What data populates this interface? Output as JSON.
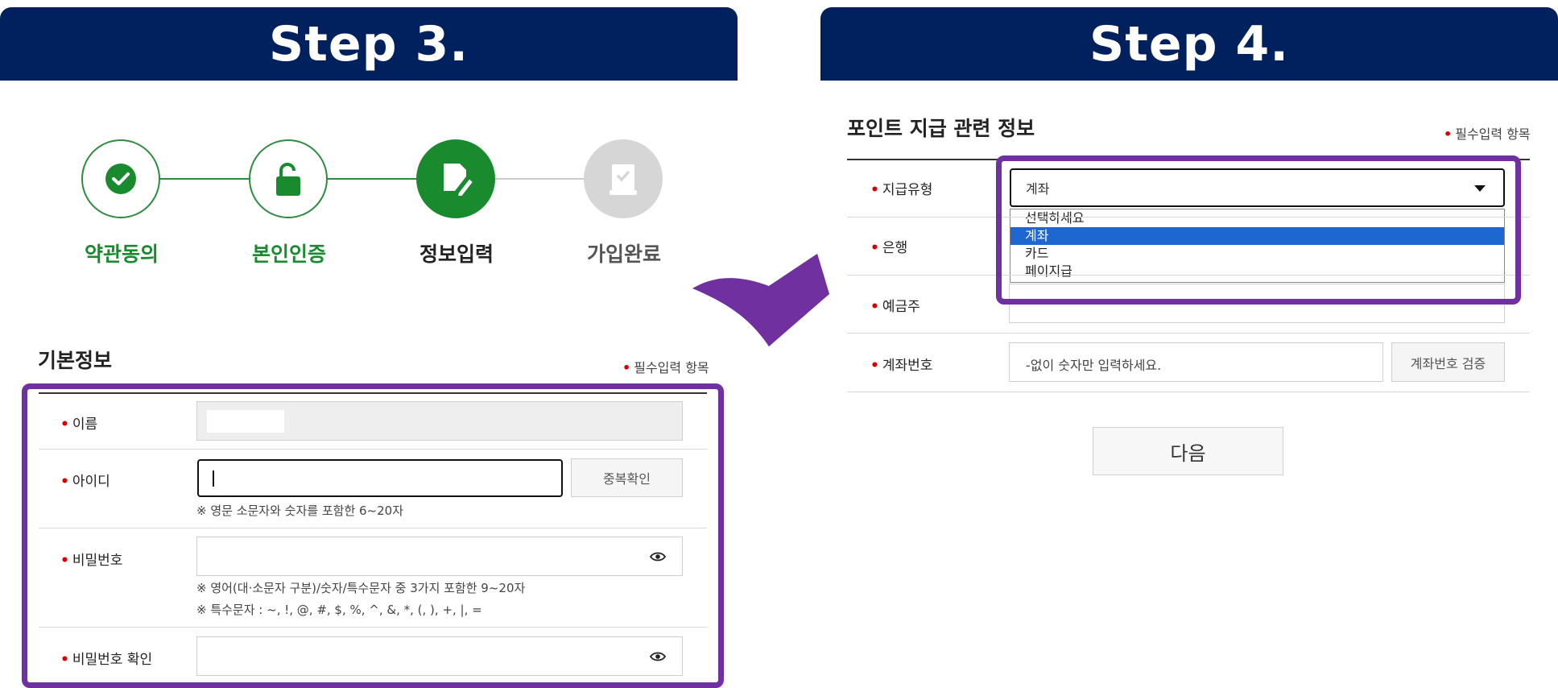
{
  "step3": {
    "header": "Step 3.",
    "progress": [
      {
        "label": "약관동의",
        "state": "done",
        "icon": "check-icon"
      },
      {
        "label": "본인인증",
        "state": "done",
        "icon": "unlock-icon"
      },
      {
        "label": "정보입력",
        "state": "current",
        "icon": "edit-icon"
      },
      {
        "label": "가입완료",
        "state": "pending",
        "icon": "document-check-icon"
      }
    ],
    "section_title": "기본정보",
    "required_note": "필수입력 항목",
    "name_label": "이름",
    "id_label": "아이디",
    "id_check_button": "중복확인",
    "id_hint": "※ 영문 소문자와 숫자를 포함한 6~20자",
    "password_label": "비밀번호",
    "password_hint1": "※ 영어(대·소문자 구분)/숫자/특수문자 중 3가지 포함한 9~20자",
    "password_hint2": "※ 특수문자 : ~, !, @, #, $, %, ^, &, *, (, ), +, |, =",
    "password_confirm_label": "비밀번호 확인"
  },
  "step4": {
    "header": "Step 4.",
    "section_title": "포인트 지급 관련 정보",
    "required_note": "필수입력 항목",
    "payment_type_label": "지급유형",
    "payment_type_value": "계좌",
    "payment_options": [
      "선택하세요",
      "계좌",
      "카드",
      "페이지급"
    ],
    "bank_label": "은행",
    "holder_label": "예금주",
    "account_label": "계좌번호",
    "account_placeholder": "-없이 숫자만 입력하세요.",
    "account_verify_button": "계좌번호 검증",
    "next_button": "다음"
  },
  "colors": {
    "header_bg": "#00215e",
    "highlight": "#7030a0",
    "green": "#1a8a2e",
    "required_dot": "#d40000",
    "selected_option": "#1e66d0"
  }
}
